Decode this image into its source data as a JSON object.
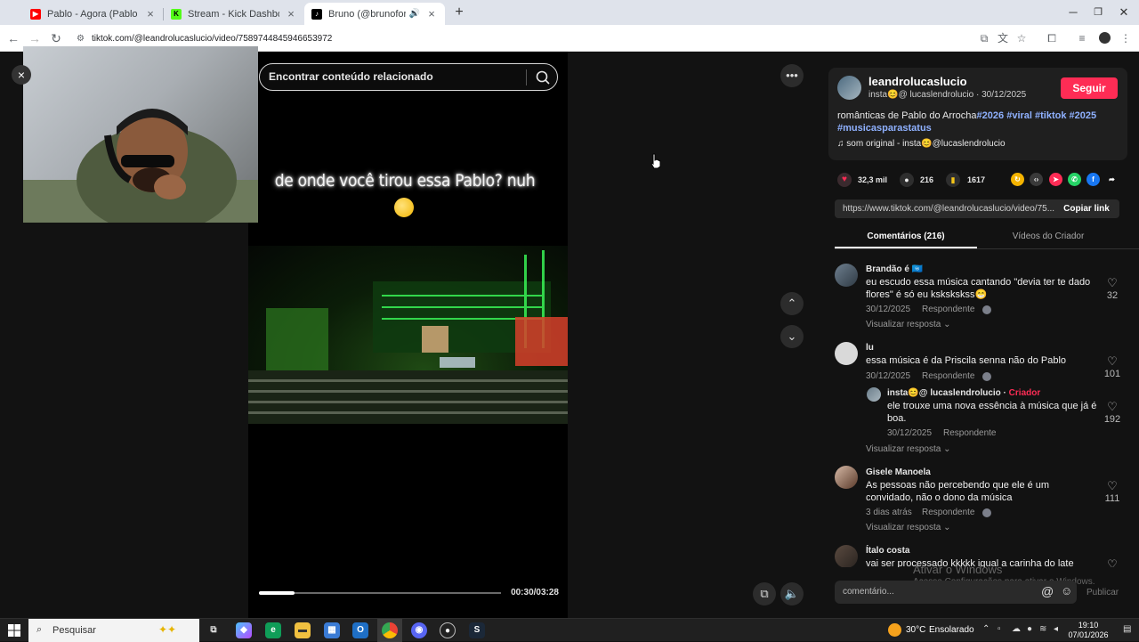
{
  "browser": {
    "tabs": [
      {
        "title": "Pablo - Agora (Pablo 20 anos) -",
        "favicon": "youtube-icon",
        "color": "#ff0000",
        "active": false
      },
      {
        "title": "Stream - Kick Dashboard",
        "favicon": "kick-icon",
        "color": "#53fc18",
        "active": false
      },
      {
        "title": "Bruno (@brunoforllan) | Tik",
        "favicon": "tiktok-icon",
        "color": "#000000",
        "active": true
      }
    ],
    "new_tab": "+",
    "url": "tiktok.com/@leandrolucaslucio/video/7589744845946653972"
  },
  "video": {
    "search_placeholder": "Encontrar conteúdo relacionado",
    "caption": "de onde você tirou essa Pablo? nuh",
    "time": "00:30/03:28",
    "progress": 0.147
  },
  "author": {
    "username": "leandrolucaslucio",
    "sub": "insta😊@ lucaslendrolucio · 30/12/2025",
    "follow": "Seguir",
    "desc_text": "românticas de Pablo do Arrocha",
    "desc_tags": [
      "#2026",
      "#viral",
      "#tiktok",
      "#2025",
      "#musicasparastatus"
    ],
    "sound": "♫  som original - insta😊@lucaslendrolucio"
  },
  "stats": {
    "likes": "32,3 mil",
    "comments": "216",
    "saves": "1617"
  },
  "share": {
    "link": "https://www.tiktok.com/@leandrolucaslucio/video/75...",
    "copy": "Copiar link"
  },
  "tabs": {
    "comments": "Comentários (216)",
    "creator": "Vídeos do Criador"
  },
  "comments": [
    {
      "name": "Brandão é 🇺🇳",
      "text": "eu escudo essa música cantando \"devia ter te dado flores\" é só eu kskskskss😁",
      "date": "30/12/2025",
      "reply": "Respondente",
      "likes": "32",
      "view": "Visualizar resposta ⌄"
    },
    {
      "name": "lu",
      "text": "essa música é da Priscila senna não do Pablo",
      "date": "30/12/2025",
      "reply": "Respondente",
      "likes": "101"
    },
    {
      "name": "insta😊@ lucaslendrolucio · ",
      "badge": "Criador",
      "text": "ele trouxe uma nova essência à música que já é boa.",
      "date": "30/12/2025",
      "reply": "Respondente",
      "likes": "192",
      "view": "Visualizar resposta ⌄"
    },
    {
      "name": "Gisele Manoela",
      "text": "As pessoas não percebendo que ele é um convidado, não o dono da música",
      "date": "3 dias atrás",
      "reply": "Respondente",
      "likes": "111",
      "view": "Visualizar resposta ⌄"
    },
    {
      "name": "Ítalo costa",
      "text": "vai ser processado kkkkk igual a carinha do late"
    }
  ],
  "composer": {
    "placeholder": "comentário...",
    "at": "@",
    "publish": "Publicar"
  },
  "windows": {
    "activate_title": "Ativar o Windows",
    "activate_sub": "Acesse Configurações para ativar o Windows."
  },
  "taskbar": {
    "search": "Pesquisar",
    "temp": "30°C",
    "weather": "Ensolarado",
    "time": "19:10",
    "date": "07/01/2026"
  }
}
